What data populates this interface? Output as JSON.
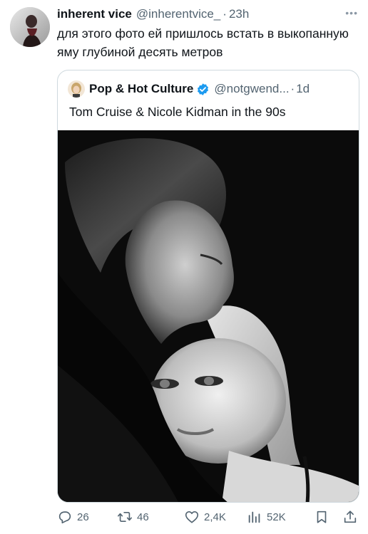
{
  "tweet": {
    "author_name": "inherent vice",
    "handle": "@inherentvice_",
    "separator": "·",
    "time": "23h",
    "more_label": "•••",
    "text": "для этого фото ей пришлось встать в выкопанную яму глубиной десять метров"
  },
  "quote": {
    "author_name": "Pop & Hot Culture",
    "handle": "@notgwend...",
    "separator": "·",
    "time": "1d",
    "text": "Tom Cruise & Nicole Kidman in the 90s"
  },
  "actions": {
    "replies": "26",
    "retweets": "46",
    "likes": "2,4K",
    "views": "52K"
  },
  "colors": {
    "text": "#0f1419",
    "secondary": "#536471",
    "border": "#cfd9de",
    "verified": "#1d9bf0"
  },
  "icons": [
    "more-icon",
    "verified-icon",
    "reply-icon",
    "retweet-icon",
    "like-icon",
    "views-icon",
    "bookmark-icon",
    "share-icon"
  ]
}
